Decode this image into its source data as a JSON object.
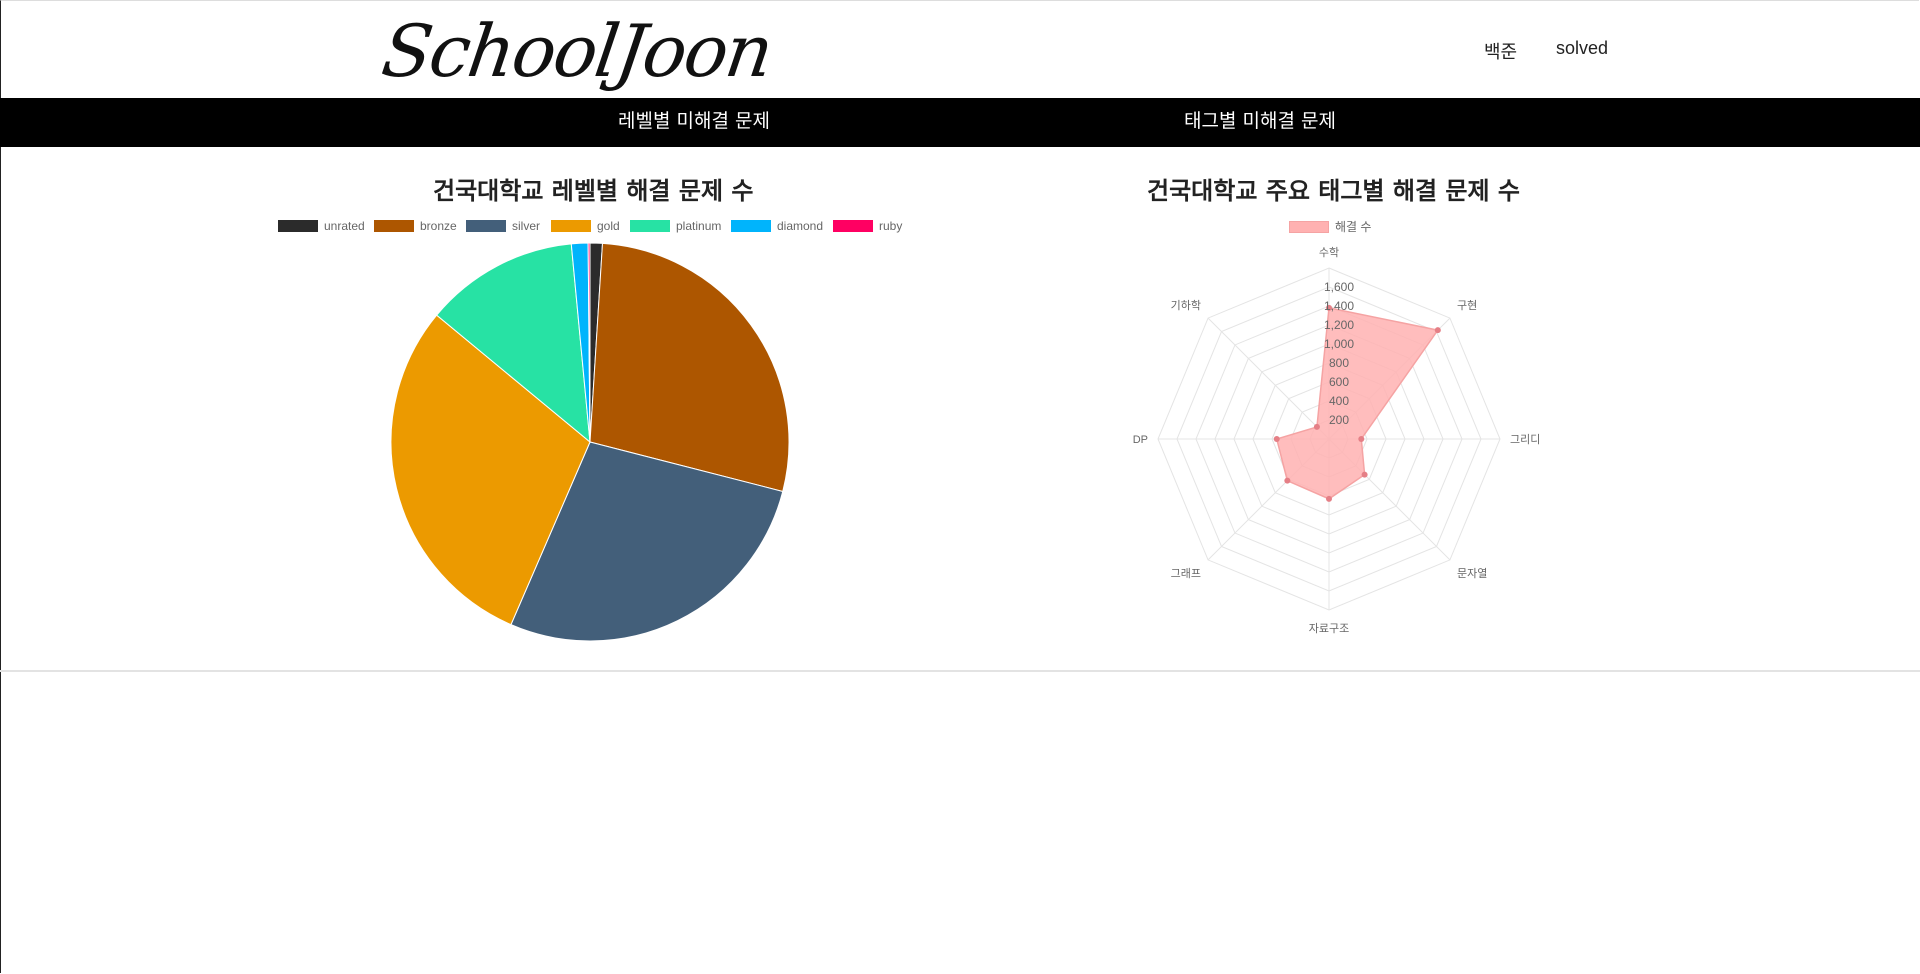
{
  "header": {
    "logo": "SchoolJoon",
    "nav": [
      "백준",
      "solved"
    ]
  },
  "menu": {
    "level_unsolved": "레벨별 미해결 문제",
    "tag_unsolved": "태그별 미해결 문제"
  },
  "level_chart": {
    "title": "건국대학교 레벨별 해결 문제 수"
  },
  "tag_chart": {
    "title": "건국대학교 주요 태그별 해결 문제 수"
  },
  "chart_data": [
    {
      "type": "pie",
      "title": "건국대학교 레벨별 해결 문제 수",
      "legend_position": "top",
      "categories": [
        "unrated",
        "bronze",
        "silver",
        "gold",
        "platinum",
        "diamond",
        "ruby"
      ],
      "values": [
        1.0,
        28.0,
        27.5,
        29.5,
        12.5,
        1.35,
        0.15
      ],
      "colors": [
        "#2b2b2b",
        "#ad5600",
        "#435f7a",
        "#ec9a00",
        "#27e2a4",
        "#00b4fc",
        "#ff0062"
      ]
    },
    {
      "type": "radar",
      "title": "건국대학교 주요 태그별 해결 문제 수",
      "legend_position": "top",
      "categories": [
        "수학",
        "구현",
        "그리디",
        "문자열",
        "자료구조",
        "그래프",
        "DP",
        "기하학"
      ],
      "series": [
        {
          "name": "해결 수",
          "values": [
            1380,
            1620,
            340,
            530,
            630,
            620,
            550,
            180
          ]
        }
      ],
      "r_ticks": [
        "200",
        "400",
        "600",
        "800",
        "1,000",
        "1,200",
        "1,400",
        "1,600"
      ],
      "r_max": 1800,
      "grid": true,
      "fill_color": "#ffb1b1",
      "line_color": "#f5a3a3",
      "point_color": "#e57f86"
    }
  ]
}
